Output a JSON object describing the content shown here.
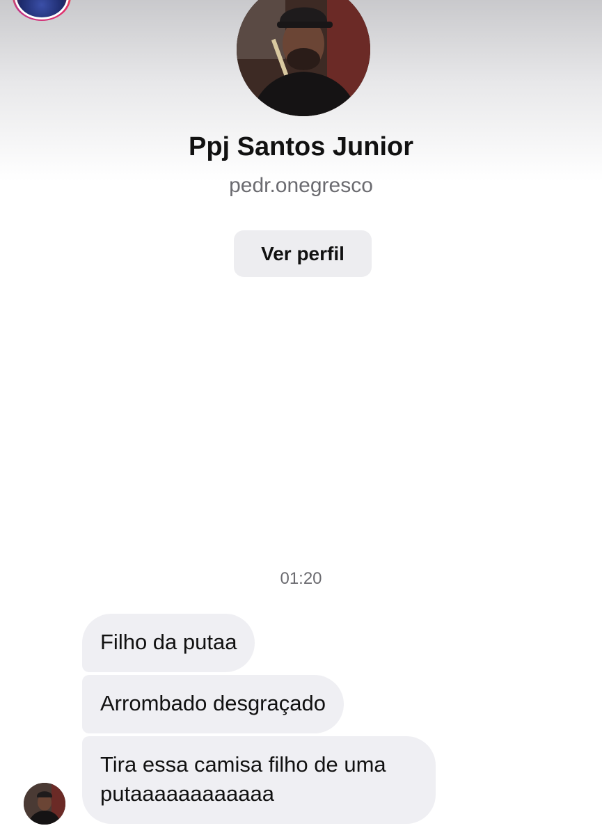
{
  "header": {
    "corner_avatar_icon": "story-avatar"
  },
  "profile": {
    "name": "Ppj Santos Junior",
    "handle": "pedr.onegresco",
    "view_profile_label": "Ver perfil",
    "avatar_icon": "profile-photo"
  },
  "conversation": {
    "timestamp": "01:20",
    "messages": [
      {
        "text": "Filho da putaa"
      },
      {
        "text": "Arrombado desgraçado"
      },
      {
        "text": "Tira essa camisa filho de uma putaaaaaaaaaaaa"
      }
    ],
    "sender_avatar_icon": "sender-avatar"
  },
  "colors": {
    "bubble_bg": "#efeff3",
    "button_bg": "#ededf0",
    "secondary_text": "#6b6b70",
    "primary_text": "#111111"
  }
}
